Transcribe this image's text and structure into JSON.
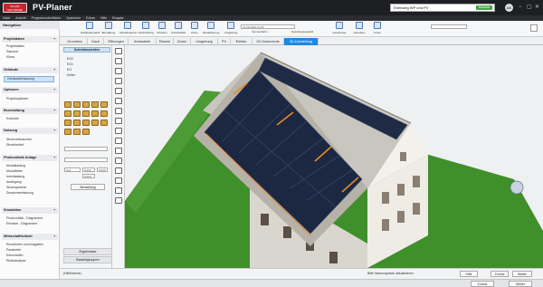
{
  "app": {
    "logo_text": "SOLAR SOFTWARE",
    "title": "PV-Planer",
    "project": "Ebenweg WP und PV",
    "project_badge": "Nutzbar",
    "avatar": "LK",
    "min": "−",
    "max": "▢",
    "close": "✕"
  },
  "menu": [
    "Datei",
    "Ansicht",
    "Programmoberfläche",
    "Speichern",
    "Extras",
    "Hilfe",
    "Eingabe"
  ],
  "toolbar": [
    {
      "label": "Gebäudemodell",
      "icon": "building-model-icon"
    },
    {
      "label": "Bemaßung",
      "icon": "dimension-icon"
    },
    {
      "label": "Schattenkurve",
      "icon": "shadow-curve-icon"
    },
    {
      "label": "Nordrichtung",
      "icon": "north-direction-icon"
    },
    {
      "label": "Drucken",
      "icon": "print-icon"
    },
    {
      "label": "Ansichtsbild",
      "icon": "view-image-icon"
    },
    {
      "label": "Zoom",
      "icon": "zoom-icon"
    },
    {
      "label": "Visualisierung",
      "icon": "visualization-icon"
    },
    {
      "label": "Umgebung",
      "icon": "environment-icon"
    },
    {
      "label": "Sonnenbahn",
      "icon": "sun-path-icon"
    },
    {
      "label": "Geschosse",
      "icon": "floors-icon"
    },
    {
      "label": "Neuesten",
      "icon": "latest-icon"
    },
    {
      "label": "Linien",
      "icon": "lines-icon"
    }
  ],
  "date_field": {
    "date": "21.06.2024",
    "time": "12:00"
  },
  "search_label": "Geschossauswahl",
  "tabs": [
    "Grundriss",
    "Dach",
    "Öffnungen",
    "Anbauteile",
    "Räume",
    "Zonen",
    "Umgebung",
    "PV",
    "Elektro",
    "2D-Dokumente",
    "3D-Darstellung"
  ],
  "active_tab": "3D-Darstellung",
  "nav": {
    "title": "Navigation",
    "sections": [
      {
        "title": "Projektdaten",
        "items": [
          "Projektdaten",
          "Standort",
          "Klima"
        ]
      },
      {
        "title": "Gebäude",
        "items": [
          "Gebäudeerfassung"
        ]
      },
      {
        "title": "Optionen",
        "items": [
          "Projektoptionen"
        ]
      },
      {
        "title": "Beschattung",
        "items": [
          "Kontrolle"
        ]
      },
      {
        "title": "Nutzung",
        "items": [
          "Stromverbraucher",
          "Strombedarf"
        ]
      },
      {
        "title": "Photovoltaik Anlage",
        "items": [
          "Modulkatalog",
          "Modulfelder",
          "Invertkatalog",
          "Auslegung",
          "Stromspeicher",
          "Zusammenfassung"
        ]
      },
      {
        "title": "Simulation",
        "items": [
          "Photovoltaik - Diagramme",
          "Ertrasse - Diagramme"
        ]
      },
      {
        "title": "Wirtschaftlichkeit",
        "items": [
          "Einnahmen und Ausgaben",
          "Parameter",
          "Kennzahlen",
          "Risikoanalyse"
        ]
      }
    ]
  },
  "mid": {
    "header": "Schnittansichten",
    "tree": [
      "EG2",
      "EG1",
      "EG",
      "Keller"
    ],
    "inputs": [
      "Aus",
      "0.000",
      "0.000",
      "0.000"
    ],
    "button": "Bemaßung",
    "lower_tabs": [
      "Ergebnisse",
      "Bauteilgruppen"
    ]
  },
  "status": {
    "left": "(Hilfeinserts)",
    "center": "Bitte Warnungsliste aktualisieren",
    "help": "Hilfe",
    "back": "Zurück",
    "fwd": "Weiter"
  },
  "bottom": {
    "back": "Zurück",
    "fwd": "Weiter"
  },
  "colors": {
    "accent": "#1e88e5",
    "titlebar": "#1d1f22",
    "roof_pv": "#1f2a44",
    "grass": "#3f8f2b"
  }
}
